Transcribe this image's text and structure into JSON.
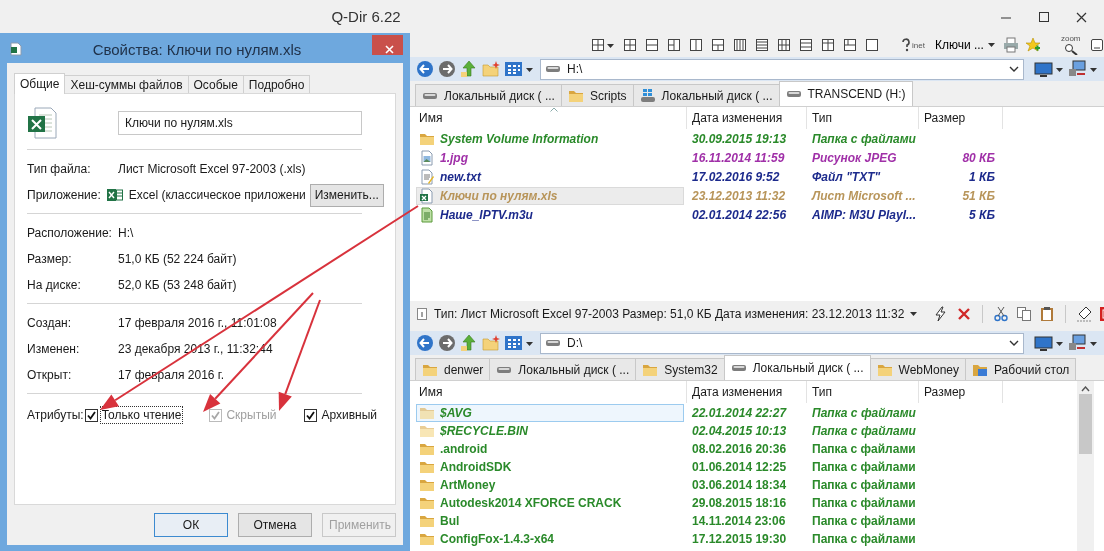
{
  "window": {
    "title": "Q-Dir 6.22"
  },
  "dialog": {
    "title": "Свойства: Ключи по нулям.xls",
    "tabs": [
      {
        "label": "Общие",
        "selected": true
      },
      {
        "label": "Хеш-суммы файлов",
        "selected": false
      },
      {
        "label": "Особые",
        "selected": false
      },
      {
        "label": "Подробно",
        "selected": false
      }
    ],
    "file_name": "Ключи по нулям.xls",
    "sections": [
      {
        "rows": [
          {
            "kind": "text",
            "label": "Тип файла:",
            "value": "Лист Microsoft Excel 97-2003 (.xls)"
          },
          {
            "kind": "app",
            "label": "Приложение:",
            "value": "Excel (классическое приложени",
            "button": "Изменить..."
          }
        ]
      },
      {
        "rows": [
          {
            "kind": "text",
            "label": "Расположение:",
            "value": "H:\\"
          },
          {
            "kind": "text",
            "label": "Размер:",
            "value": "51,0 КБ (52 224 байт)"
          },
          {
            "kind": "text",
            "label": "На диске:",
            "value": "52,0 КБ (53 248 байт)"
          }
        ]
      },
      {
        "rows": [
          {
            "kind": "text",
            "label": "Создан:",
            "value": "17 февраля 2016 г., 11:01:08"
          },
          {
            "kind": "text",
            "label": "Изменен:",
            "value": "23 декабря 2013 г., 11:32:44"
          },
          {
            "kind": "text",
            "label": "Открыт:",
            "value": "17 февраля 2016 г."
          }
        ]
      }
    ],
    "attributes": {
      "label": "Атрибуты:",
      "items": [
        {
          "label": "Только чтение",
          "checked": true,
          "disabled": false,
          "focused": true
        },
        {
          "label": "Скрытый",
          "checked": true,
          "disabled": true,
          "focused": false
        },
        {
          "label": "Архивный",
          "checked": true,
          "disabled": false,
          "focused": false
        }
      ]
    },
    "buttons": [
      {
        "label": "ОК",
        "default": true,
        "disabled": false
      },
      {
        "label": "Отмена",
        "default": false,
        "disabled": false
      },
      {
        "label": "Применить",
        "default": false,
        "disabled": true
      }
    ]
  },
  "toolbar": {
    "inet_label": "inet",
    "dropdown": "Ключи ...",
    "zoom_label": "zoom"
  },
  "panes": [
    {
      "address": "H:\\",
      "active": false,
      "tabs": [
        {
          "label": "Локальный диск ( ...",
          "kind": "drive",
          "selected": false
        },
        {
          "label": "Scripts",
          "kind": "folder",
          "selected": false
        },
        {
          "label": "Локальный диск ( ...",
          "kind": "system-drive",
          "selected": false
        },
        {
          "label": "TRANSCEND (H:)",
          "kind": "drive",
          "selected": true
        }
      ],
      "columns": [
        {
          "label": "Имя",
          "sorted": true
        },
        {
          "label": "Дата изменения",
          "sorted": false
        },
        {
          "label": "Тип",
          "sorted": false
        },
        {
          "label": "Размер",
          "sorted": false
        }
      ],
      "rows": [
        {
          "name": "System Volume Information",
          "date": "30.09.2015 19:13",
          "type": "Папка с файлами",
          "kind": "folder",
          "color": "#2a8a2a",
          "italic": true,
          "selected": false
        },
        {
          "name": "1.jpg",
          "date": "16.11.2014 11:59",
          "type": "Рисунок JPEG",
          "size": "80 КБ",
          "kind": "image",
          "color": "#a030a8",
          "italic": true,
          "selected": false
        },
        {
          "name": "new.txt",
          "date": "17.02.2016 9:52",
          "type": "Файл \"TXT\"",
          "size": "1 КБ",
          "kind": "text",
          "color": "#1c2a8c",
          "italic": true,
          "selected": false
        },
        {
          "name": "Ключи по нулям.xls",
          "date": "23.12.2013 11:32",
          "type": "Лист Microsoft ...",
          "size": "51 КБ",
          "kind": "excel",
          "color": "#b8955a",
          "italic": true,
          "selected": true
        },
        {
          "name": "Наше_IPTV.m3u",
          "date": "02.01.2014 22:56",
          "type": "AIMP: M3U Playl...",
          "size": "5 КБ",
          "kind": "playlist",
          "color": "#1c2a8c",
          "italic": true,
          "selected": false
        }
      ]
    },
    {
      "address": "D:\\",
      "active": true,
      "tabs": [
        {
          "label": "denwer",
          "kind": "folder",
          "selected": false
        },
        {
          "label": "Локальный диск ( ...",
          "kind": "drive",
          "selected": false
        },
        {
          "label": "System32",
          "kind": "folder",
          "selected": false
        },
        {
          "label": "Локальный диск ( ...",
          "kind": "drive",
          "selected": true
        },
        {
          "label": "WebMoney",
          "kind": "folder",
          "selected": false
        },
        {
          "label": "Рабочий стол",
          "kind": "desktop",
          "selected": false
        }
      ],
      "columns": [
        {
          "label": "Имя",
          "sorted": false
        },
        {
          "label": "Дата изменения",
          "sorted": false
        },
        {
          "label": "Тип",
          "sorted": false
        },
        {
          "label": "Размер",
          "sorted": false
        }
      ],
      "rows": [
        {
          "name": "$AVG",
          "date": "22.01.2014 22:27",
          "type": "Папка с файлами",
          "kind": "folder",
          "color": "#2a8a2a",
          "italic": true,
          "selected": true
        },
        {
          "name": "$RECYCLE.BIN",
          "date": "02.04.2015 10:13",
          "type": "Папка с файлами",
          "kind": "folder",
          "color": "#2a8a2a",
          "italic": true,
          "selected": false
        },
        {
          "name": ".android",
          "date": "08.02.2016 20:36",
          "type": "Папка с файлами",
          "kind": "folder",
          "color": "#2a8a2a",
          "italic": false,
          "selected": false
        },
        {
          "name": "AndroidSDK",
          "date": "01.06.2014 12:25",
          "type": "Папка с файлами",
          "kind": "folder",
          "color": "#2a8a2a",
          "italic": false,
          "selected": false
        },
        {
          "name": "ArtMoney",
          "date": "03.06.2014 18:34",
          "type": "Папка с файлами",
          "kind": "folder",
          "color": "#2a8a2a",
          "italic": false,
          "selected": false
        },
        {
          "name": "Autodesk2014 XFORCE CRACK",
          "date": "29.08.2015 18:16",
          "type": "Папка с файлами",
          "kind": "folder",
          "color": "#2a8a2a",
          "italic": false,
          "selected": false
        },
        {
          "name": "Bul",
          "date": "14.11.2014 23:06",
          "type": "Папка с файлами",
          "kind": "folder",
          "color": "#2a8a2a",
          "italic": false,
          "selected": false
        },
        {
          "name": "ConfigFox-1.4.3-x64",
          "date": "17.12.2015 19:30",
          "type": "Папка с файлами",
          "kind": "folder",
          "color": "#2a8a2a",
          "italic": false,
          "selected": false
        }
      ]
    }
  ],
  "status_bar": {
    "text": "Тип: Лист Microsoft Excel 97-2003 Размер: 51,0 КБ Дата изменения: 23.12.2013 11:32"
  }
}
